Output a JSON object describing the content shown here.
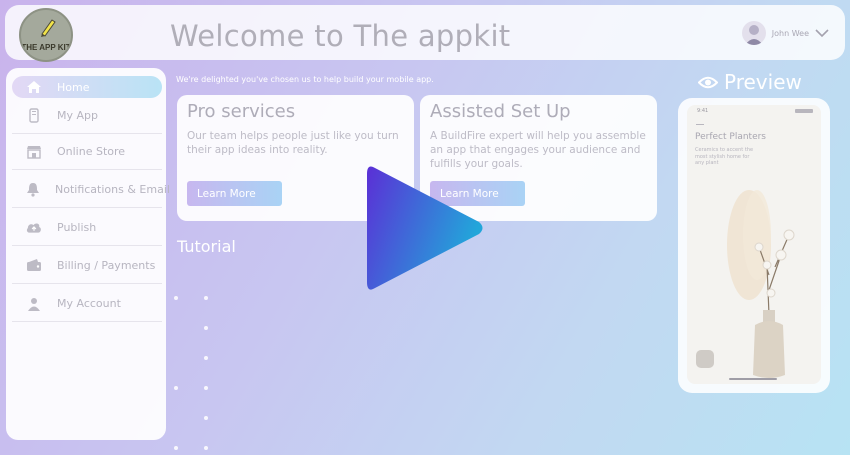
{
  "header": {
    "logo_text": "THE APP KIT",
    "title": "Welcome to The appkit",
    "user_name": "John Wee"
  },
  "sidebar": {
    "items": [
      {
        "label": "Home",
        "icon": "home-icon",
        "active": true
      },
      {
        "label": "My App",
        "icon": "phone-icon"
      },
      {
        "label": "Online Store",
        "icon": "store-icon"
      },
      {
        "label": "Notifications & Email",
        "icon": "bell-icon"
      },
      {
        "label": "Publish",
        "icon": "cloud-upload-icon"
      },
      {
        "label": "Billing / Payments",
        "icon": "wallet-icon"
      },
      {
        "label": "My Account",
        "icon": "user-icon"
      }
    ]
  },
  "main": {
    "intro": "We're delighted you've chosen us to help build your mobile app.",
    "cards": [
      {
        "title": "Pro services",
        "desc": "Our team helps people just like you turn their app ideas into reality.",
        "button": "Learn More"
      },
      {
        "title": "Assisted Set Up",
        "desc": "A BuildFire expert will help you assemble an app that engages your audience and fulfills your goals.",
        "button": "Learn More"
      }
    ],
    "tutorial": "Tutorial"
  },
  "preview": {
    "label": "Preview",
    "phone": {
      "time": "9:41",
      "title": "Perfect Planters",
      "subtitle": "Ceramics to accent the most stylish home for any plant"
    }
  },
  "colors": {
    "accent_gradient_start": "#5b2fd6",
    "accent_gradient_end": "#22a6da",
    "text_muted": "#b0aeb8"
  }
}
